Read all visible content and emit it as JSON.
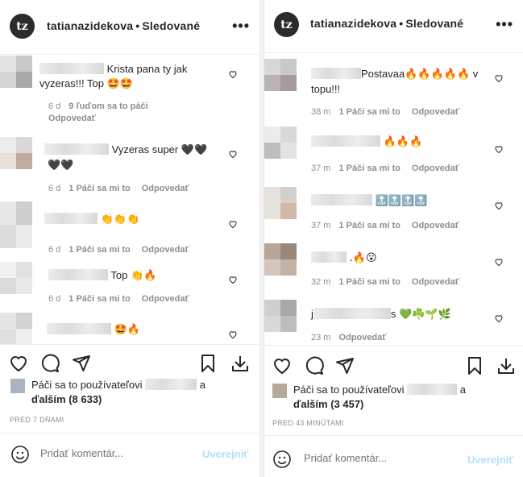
{
  "left": {
    "header": {
      "username": "tatianazidekova",
      "dot": "•",
      "follow": "Sledované",
      "more": "•••",
      "logo": "tz"
    },
    "comments": [
      {
        "text": "Krista pana ty jak vyzeras!!! Top",
        "text1": "Krista pana ty jak",
        "text2": "vyzeras!!! Top",
        "emoji": "🤩🤩",
        "time": "6 d",
        "likes": "9 ľuďom sa to páči",
        "reply": "Odpovedať"
      },
      {
        "text": "Vyzeras super",
        "emoji1": "🖤🖤",
        "emoji2": "🖤🖤",
        "time": "6 d",
        "likes": "1 Páči sa mi to",
        "reply": "Odpovedať"
      },
      {
        "emoji": "👏👏👏",
        "time": "6 d",
        "likes": "1 Páči sa mi to",
        "reply": "Odpovedať"
      },
      {
        "text": "Top",
        "emoji": "👏🔥",
        "time": "6 d",
        "likes": "1 Páči sa mi to",
        "reply": "Odpovedať"
      },
      {
        "emoji": "🤩🔥"
      }
    ],
    "likes_prefix": "Páči sa to používateľovi",
    "likes_a": "a",
    "likes_more": "ďalším (8 633)",
    "ago": "PRED 7 DŇAMI",
    "comment_placeholder": "Pridať komentár...",
    "post_label": "Uverejniť"
  },
  "right": {
    "header": {
      "username": "tatianazidekova",
      "dot": "•",
      "follow": "Sledované",
      "more": "•••",
      "logo": "tz"
    },
    "comments": [
      {
        "text1": "Postavaa",
        "emoji": "🔥🔥🔥🔥🔥",
        "text_v": "v",
        "text2": "topu!!!",
        "time": "38 m",
        "likes": "1 Páči sa mi to",
        "reply": "Odpovedať"
      },
      {
        "emoji": "🔥🔥🔥",
        "time": "37 m",
        "likes": "1 Páči sa mi to",
        "reply": "Odpovedať"
      },
      {
        "emoji": "🔝🔝🔝🔝",
        "time": "37 m",
        "likes": "1 Páči sa mi to",
        "reply": "Odpovedať"
      },
      {
        "emoji": ".🔥😮",
        "time": "32 m",
        "likes": "1 Páči sa mi to",
        "reply": "Odpovedať"
      },
      {
        "prefix": "j",
        "suffix": "s",
        "emoji": "💚☘️🌱🌿",
        "time": "23 m",
        "reply": "Odpovedať"
      }
    ],
    "likes_prefix": "Páči sa to používateľovi",
    "likes_a": "a",
    "likes_more": "ďalším (3 457)",
    "ago": "PRED 43 MINÚTAMI",
    "comment_placeholder": "Pridať komentár...",
    "post_label": "Uverejniť"
  },
  "colors": {
    "text": "#262626",
    "muted": "#8e8e8e",
    "post_disabled": "#b2dffc",
    "border": "#efefef"
  },
  "icons": [
    "heart-icon",
    "comment-icon",
    "share-icon",
    "bookmark-icon",
    "download-icon",
    "smiley-icon",
    "more-icon"
  ]
}
